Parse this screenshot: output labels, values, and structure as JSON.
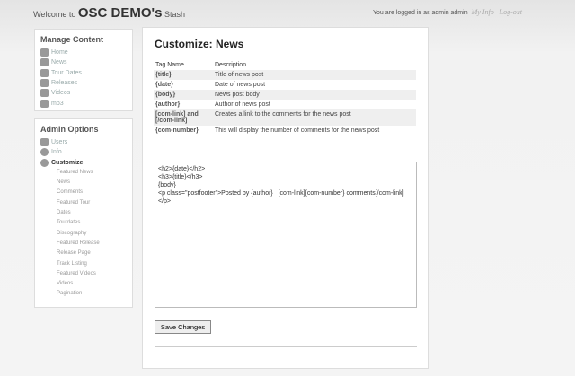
{
  "header": {
    "welcome": "Welcome to",
    "site": "OSC DEMO's",
    "stash": "Stash",
    "logged": "You are logged in as admin admin",
    "my_info": "My Info",
    "logout": "Log-out"
  },
  "manage": {
    "title": "Manage Content",
    "items": [
      "Home",
      "News",
      "Tour Dates",
      "Releases",
      "Videos",
      "mp3"
    ]
  },
  "admin": {
    "title": "Admin Options",
    "items": [
      "Users",
      "Info",
      "Customize"
    ],
    "sub": [
      "Featured News",
      "News",
      "Comments",
      "Featured Tour",
      "Dates",
      "Tourdates",
      "Discography",
      "Featured Release",
      "Release Page",
      "Track Listing",
      "Featured Videos",
      "Videos",
      "Pagination"
    ]
  },
  "main": {
    "title": "Customize: News",
    "col_tag": "Tag Name",
    "col_desc": "Description",
    "rows": [
      [
        "{title}",
        "Title of news post"
      ],
      [
        "{date}",
        "Date of news post"
      ],
      [
        "{body}",
        "News post body"
      ],
      [
        "{author}",
        "Author of news post"
      ],
      [
        "[com-link] and [/com-link]",
        "Creates a link to the comments for the news post"
      ],
      [
        "{com-number}",
        "This will display the number of comments for the news post"
      ]
    ],
    "template": "<h2>{date}</h2>\n<h3>{title}</h3>\n{body}\n<p class=\"postfooter\">Posted by {author}   [com-link]{com-number} comments[/com-link]</p>",
    "save": "Save Changes"
  }
}
